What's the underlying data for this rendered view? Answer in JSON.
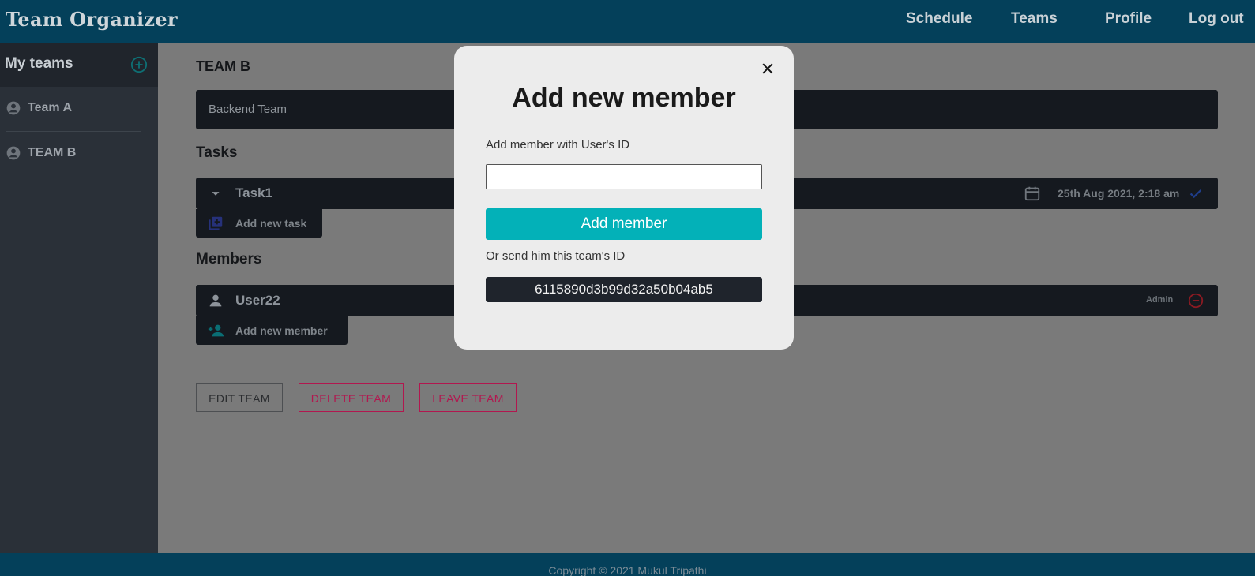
{
  "header": {
    "brand": "Team Organizer",
    "nav": [
      "Schedule",
      "Teams",
      "Profile",
      "Log out"
    ]
  },
  "sidebar": {
    "title": "My teams",
    "teams": [
      "Team A",
      "TEAM B"
    ]
  },
  "main": {
    "team_name": "TEAM B",
    "description": "Backend Team",
    "tasks_title": "Tasks",
    "tasks": [
      {
        "name": "Task1",
        "date": "25th Aug 2021, 2:18 am",
        "status": "done"
      }
    ],
    "add_task_label": "Add new task",
    "members_title": "Members",
    "members": [
      {
        "name": "User22",
        "role": "Admin"
      }
    ],
    "add_member_label": "Add new member",
    "buttons": {
      "edit": "EDIT TEAM",
      "delete": "DELETE TEAM",
      "leave": "LEAVE TEAM"
    }
  },
  "footer": {
    "copyright": "Copyright © 2021 Mukul Tripathi"
  },
  "modal": {
    "title": "Add new member",
    "input_label": "Add member with User's ID",
    "input_value": "",
    "submit_label": "Add member",
    "share_label": "Or send him this team's ID",
    "team_id": "6115890d3b99d32a50b04ab5"
  },
  "colors": {
    "header_bg": "#04405a",
    "sidebar_bg": "#2a3038",
    "accent_teal": "#03b1b8",
    "danger": "#c2185b",
    "dark_bar": "#15191f",
    "overlay": "#7a7a7a"
  }
}
